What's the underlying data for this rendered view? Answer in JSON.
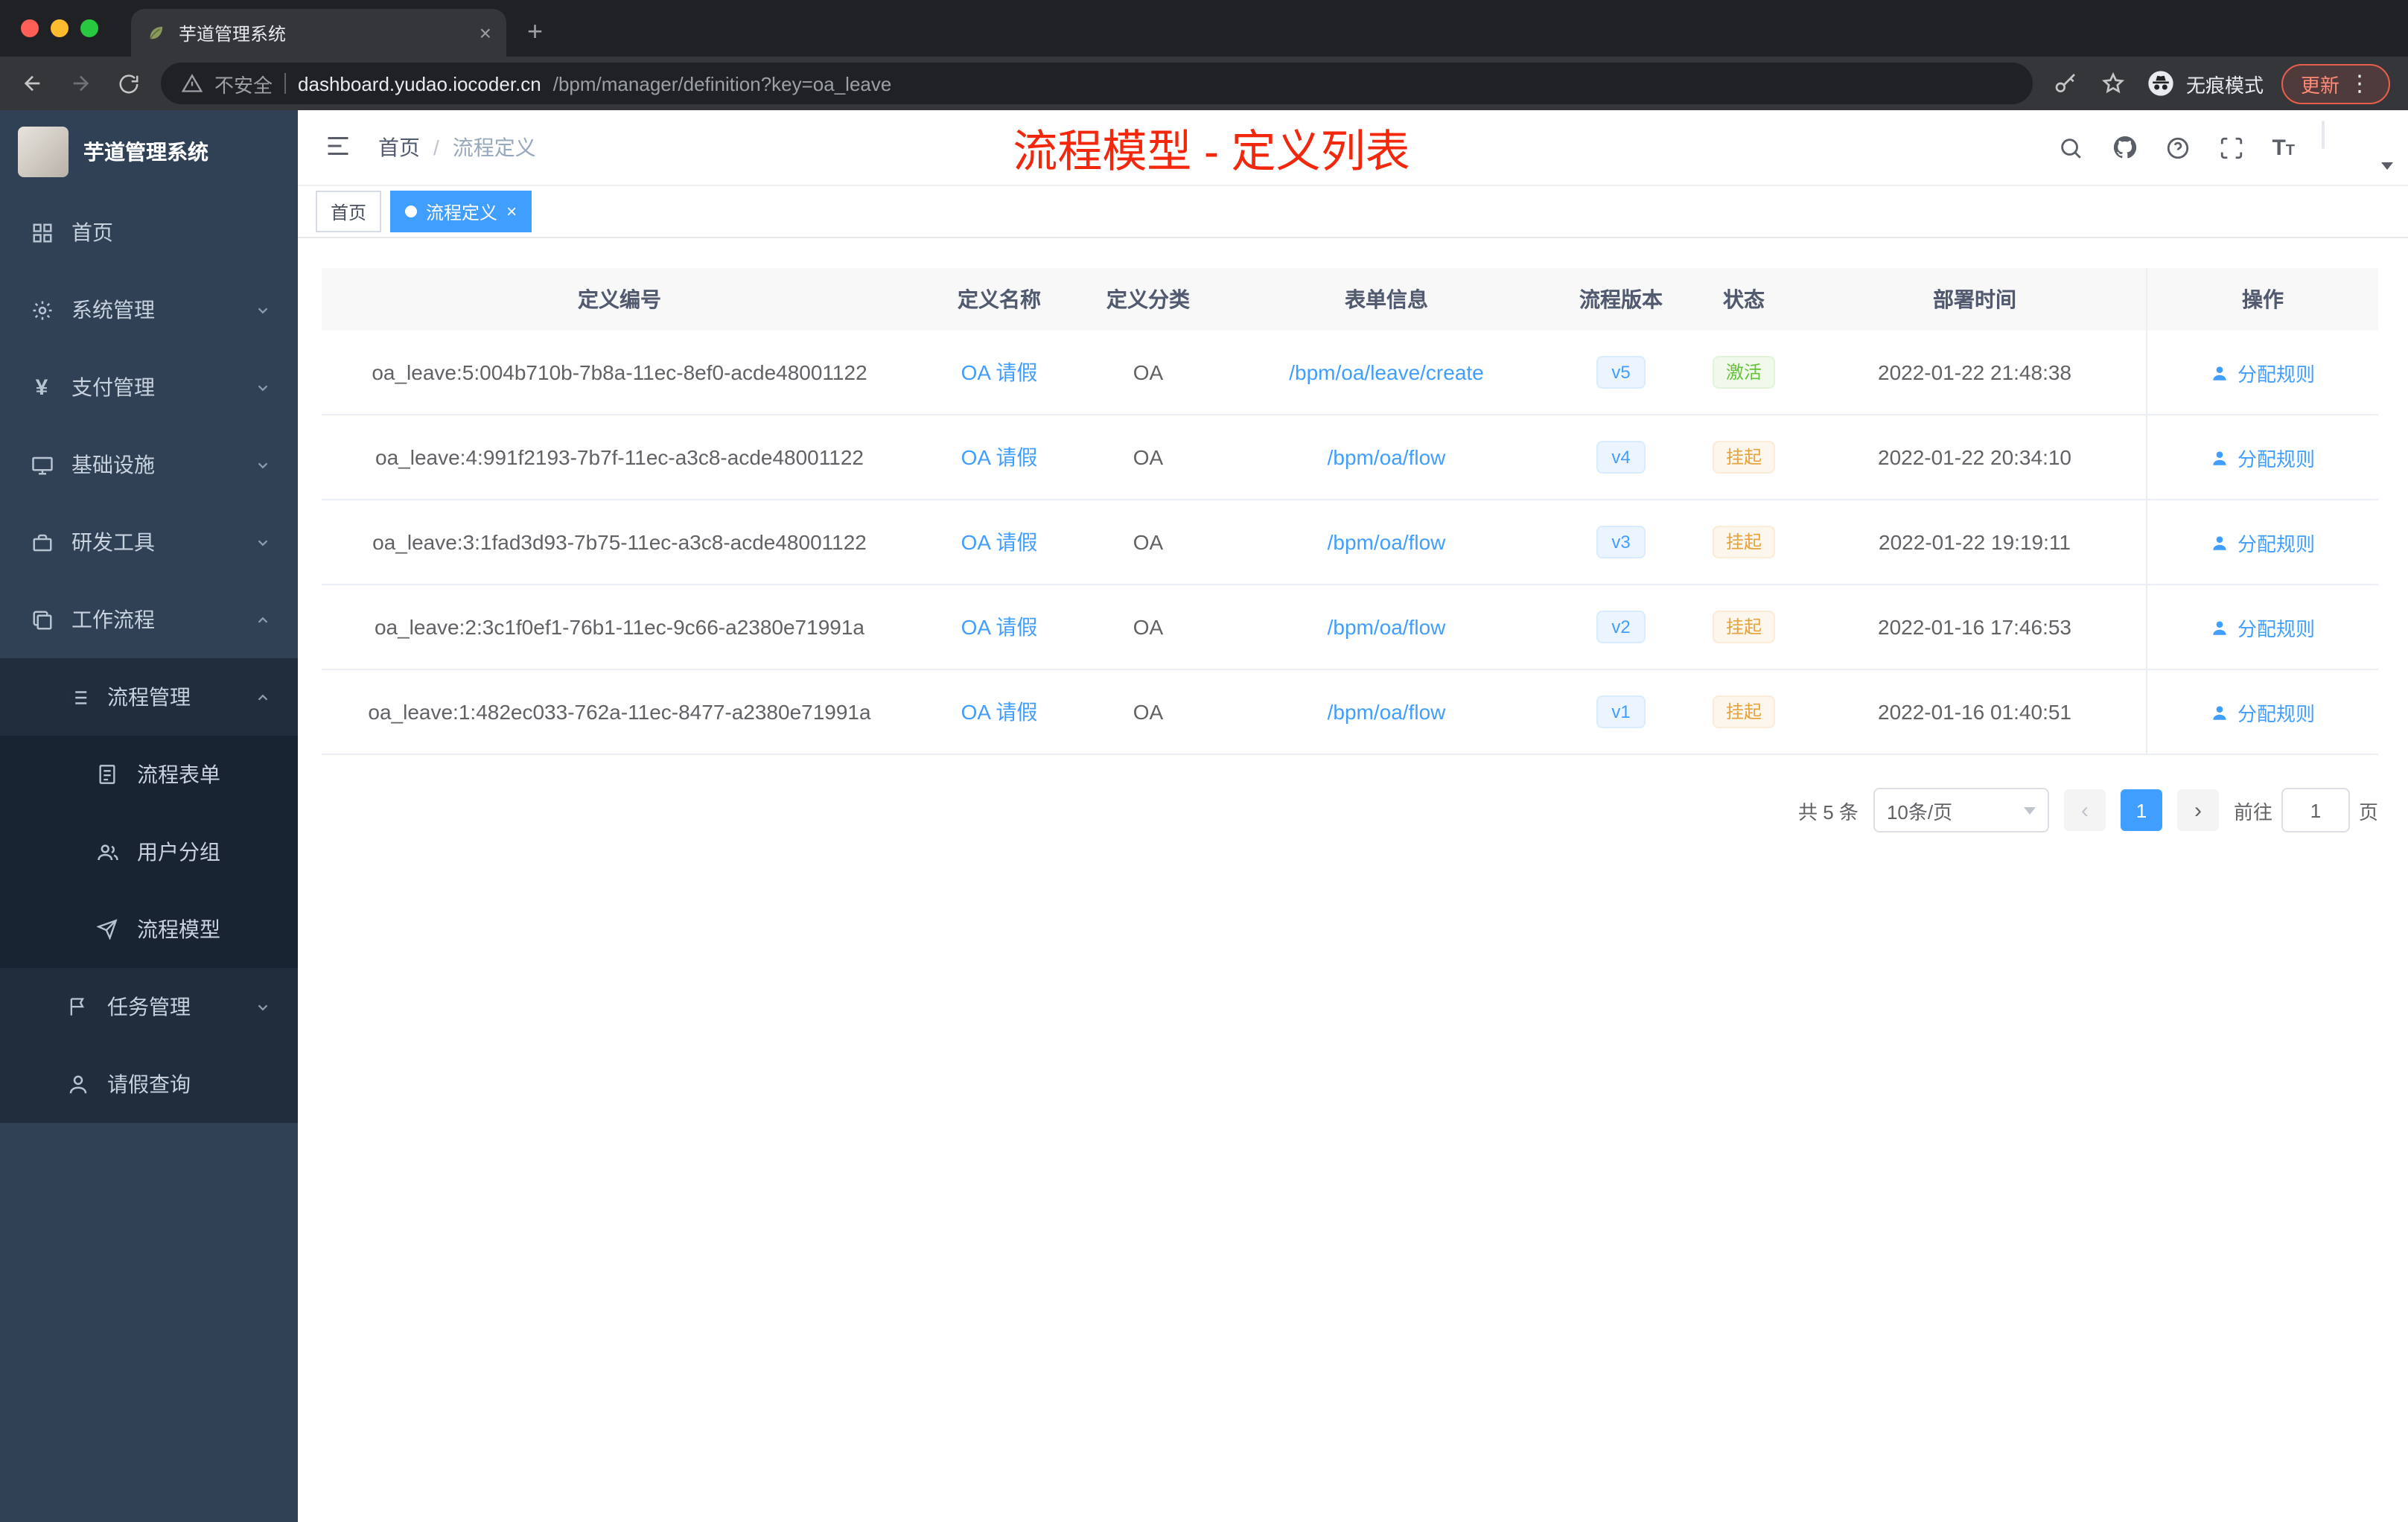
{
  "glyphs": {
    "plus": "+",
    "close": "×",
    "more": "⋮"
  },
  "browser": {
    "tab_title": "芋道管理系统",
    "not_secure": "不安全",
    "url_host": "dashboard.yudao.iocoder.cn",
    "url_path": "/bpm/manager/definition?key=oa_leave",
    "incognito_label": "无痕模式",
    "update_label": "更新"
  },
  "sidebar": {
    "brand": "芋道管理系统",
    "items": [
      {
        "label": "首页",
        "icon": "dashboard-icon",
        "level": 1
      },
      {
        "label": "系统管理",
        "icon": "gear-icon",
        "level": 1,
        "chevron": "down"
      },
      {
        "label": "支付管理",
        "icon": "yen-icon",
        "level": 1,
        "chevron": "down"
      },
      {
        "label": "基础设施",
        "icon": "monitor-icon",
        "level": 1,
        "chevron": "down"
      },
      {
        "label": "研发工具",
        "icon": "toolbox-icon",
        "level": 1,
        "chevron": "down"
      },
      {
        "label": "工作流程",
        "icon": "workflow-icon",
        "level": 1,
        "chevron": "up"
      },
      {
        "label": "流程管理",
        "icon": "list-icon",
        "level": 2,
        "chevron": "up"
      },
      {
        "label": "流程表单",
        "icon": "form-icon",
        "level": 3
      },
      {
        "label": "用户分组",
        "icon": "users-icon",
        "level": 3
      },
      {
        "label": "流程模型",
        "icon": "send-icon",
        "level": 3
      },
      {
        "label": "任务管理",
        "icon": "task-icon",
        "level": 2,
        "chevron": "down"
      },
      {
        "label": "请假查询",
        "icon": "person-icon",
        "level": 2
      }
    ]
  },
  "header": {
    "breadcrumb": {
      "home": "首页",
      "separator": "/",
      "current": "流程定义"
    },
    "annotation": "流程模型 - 定义列表"
  },
  "tags": {
    "items": [
      {
        "label": "首页",
        "active": false
      },
      {
        "label": "流程定义",
        "active": true
      }
    ]
  },
  "table": {
    "columns": [
      "定义编号",
      "定义名称",
      "定义分类",
      "表单信息",
      "流程版本",
      "状态",
      "部署时间",
      "操作"
    ],
    "rows": [
      {
        "id": "oa_leave:5:004b710b-7b8a-11ec-8ef0-acde48001122",
        "name": "OA 请假",
        "category": "OA",
        "form": "/bpm/oa/leave/create",
        "version": "v5",
        "status": "激活",
        "status_type": "success",
        "time": "2022-01-22 21:48:38",
        "action": "分配规则"
      },
      {
        "id": "oa_leave:4:991f2193-7b7f-11ec-a3c8-acde48001122",
        "name": "OA 请假",
        "category": "OA",
        "form": "/bpm/oa/flow",
        "version": "v4",
        "status": "挂起",
        "status_type": "warning",
        "time": "2022-01-22 20:34:10",
        "action": "分配规则"
      },
      {
        "id": "oa_leave:3:1fad3d93-7b75-11ec-a3c8-acde48001122",
        "name": "OA 请假",
        "category": "OA",
        "form": "/bpm/oa/flow",
        "version": "v3",
        "status": "挂起",
        "status_type": "warning",
        "time": "2022-01-22 19:19:11",
        "action": "分配规则"
      },
      {
        "id": "oa_leave:2:3c1f0ef1-76b1-11ec-9c66-a2380e71991a",
        "name": "OA 请假",
        "category": "OA",
        "form": "/bpm/oa/flow",
        "version": "v2",
        "status": "挂起",
        "status_type": "warning",
        "time": "2022-01-16 17:46:53",
        "action": "分配规则"
      },
      {
        "id": "oa_leave:1:482ec033-762a-11ec-8477-a2380e71991a",
        "name": "OA 请假",
        "category": "OA",
        "form": "/bpm/oa/flow",
        "version": "v1",
        "status": "挂起",
        "status_type": "warning",
        "time": "2022-01-16 01:40:51",
        "action": "分配规则"
      }
    ]
  },
  "pagination": {
    "total": "共 5 条",
    "page_size": "10条/页",
    "prev": "‹",
    "next": "›",
    "current": "1",
    "goto_prefix": "前往",
    "goto_value": "1",
    "goto_suffix": "页"
  },
  "colors": {
    "accent": "#409eff",
    "annotation_red": "#f2270c",
    "status_active": "#67c23a",
    "status_suspended": "#e6a23c",
    "sidebar_bg": "#304156"
  }
}
